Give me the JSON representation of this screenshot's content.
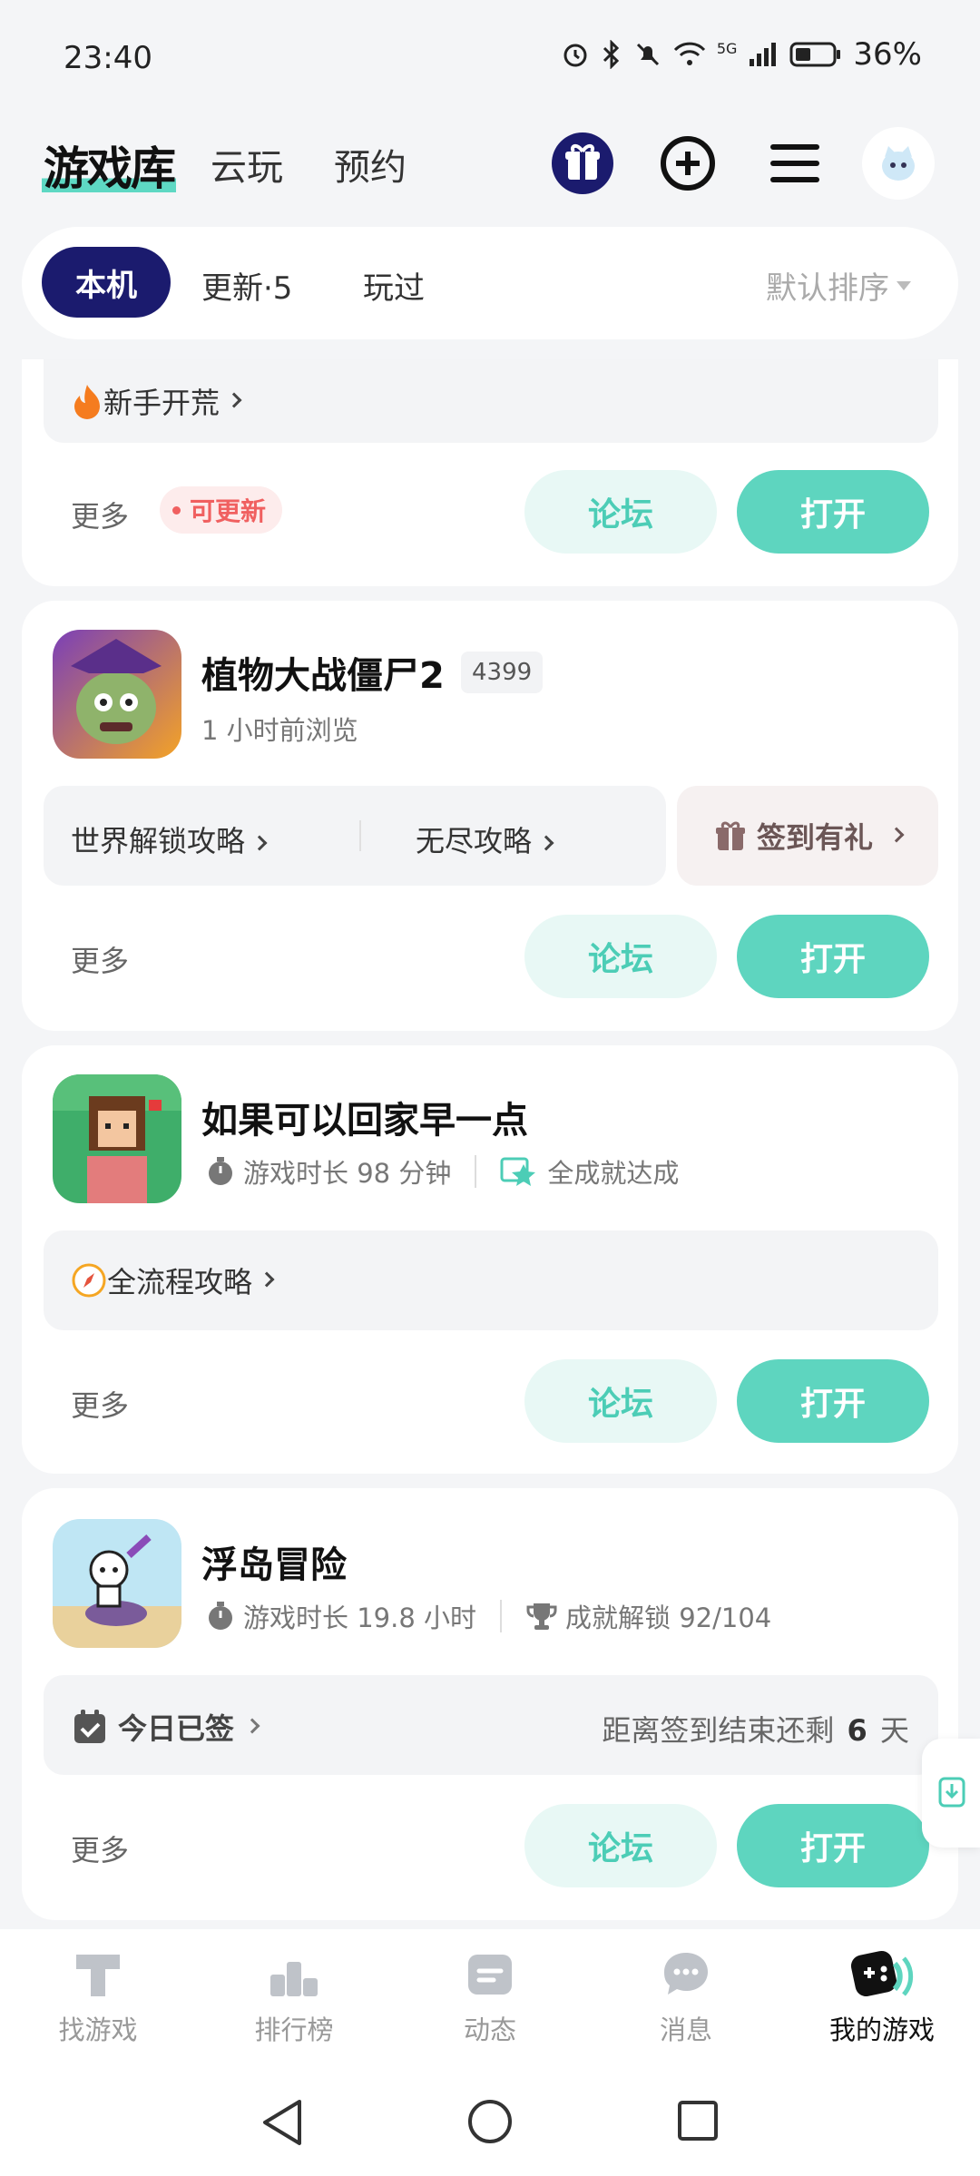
{
  "status": {
    "time": "23:40",
    "network": "5G",
    "battery": "36%"
  },
  "header": {
    "title": "游戏库",
    "tabs": [
      "云玩",
      "预约"
    ]
  },
  "filters": {
    "tabs": [
      "本机",
      "更新·5",
      "玩过"
    ],
    "sort": "默认排序"
  },
  "card0": {
    "guide": "新手开荒",
    "more": "更多",
    "badge": "可更新",
    "forum": "论坛",
    "open": "打开"
  },
  "card1": {
    "name": "植物大战僵尸2",
    "tag": "4399",
    "sub": "1 小时前浏览",
    "guides": [
      "世界解锁攻略",
      "无尽攻略"
    ],
    "checkin": "签到有礼",
    "more": "更多",
    "forum": "论坛",
    "open": "打开"
  },
  "card2": {
    "name": "如果可以回家早一点",
    "playtime": "游戏时长 98 分钟",
    "achievement": "全成就达成",
    "guide": "全流程攻略",
    "more": "更多",
    "forum": "论坛",
    "open": "打开"
  },
  "card3": {
    "name": "浮岛冒险",
    "playtime": "游戏时长 19.8 小时",
    "achievement": "成就解锁 92/104",
    "checked": "今日已签",
    "remaining_prefix": "距离签到结束还剩",
    "remaining_days": "6",
    "remaining_suffix": "天",
    "more": "更多",
    "forum": "论坛",
    "open": "打开"
  },
  "nav": {
    "items": [
      "找游戏",
      "排行榜",
      "动态",
      "消息",
      "我的游戏"
    ],
    "active_index": 4
  },
  "colors": {
    "accent": "#5ed5bf",
    "primary_dark": "#1b1b6e",
    "update_red": "#f06060"
  }
}
